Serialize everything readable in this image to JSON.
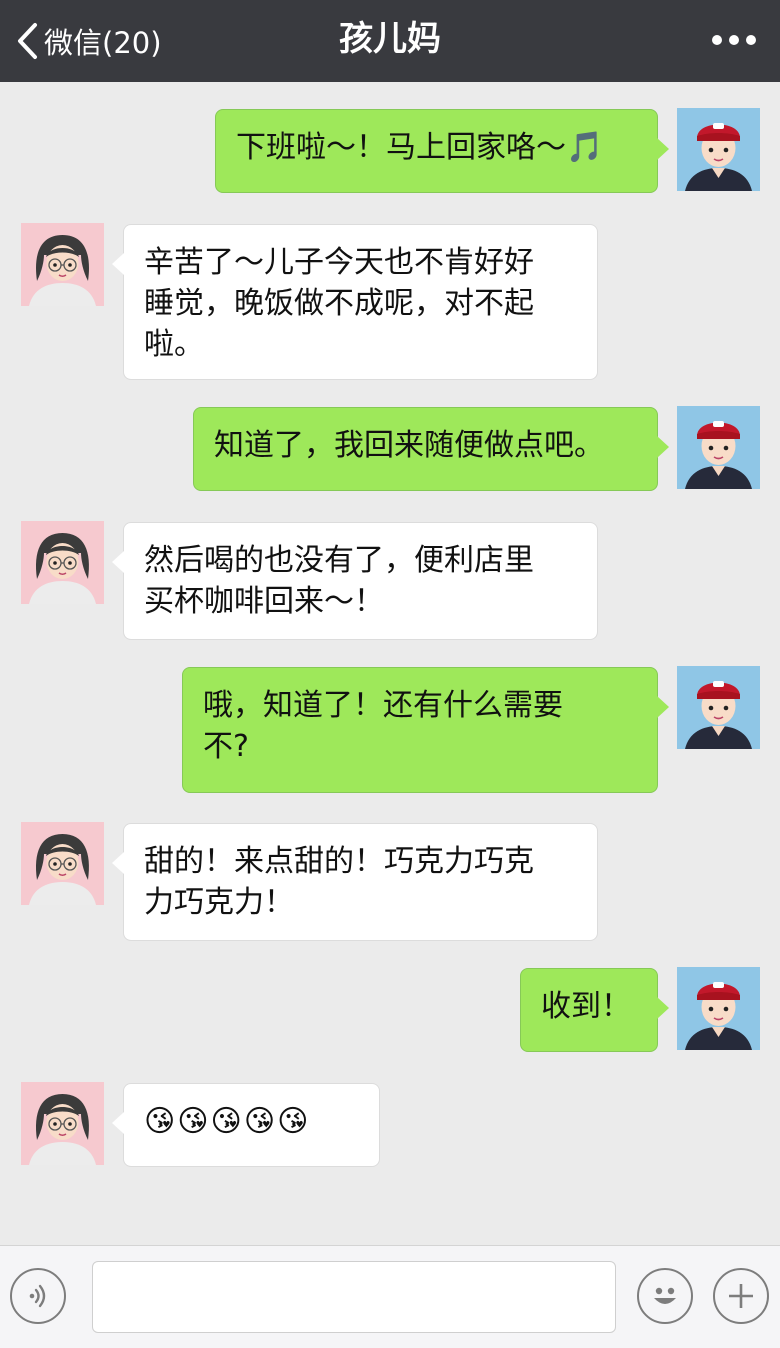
{
  "header": {
    "back_label": "微信(20)",
    "title": "孩儿妈",
    "more_icon": "more-dots-icon"
  },
  "messages": [
    {
      "side": "right",
      "text": "下班啦～！马上回家咯～🎵"
    },
    {
      "side": "left",
      "text": "辛苦了～儿子今天也不肯好好\n睡觉，晚饭做不成呢，对不起\n啦。"
    },
    {
      "side": "right",
      "text": "知道了，我回来随便做点吧。"
    },
    {
      "side": "left",
      "text": "然后喝的也没有了，便利店里\n买杯咖啡回来～！"
    },
    {
      "side": "right",
      "text": "哦，知道了！还有什么需要\n不?"
    },
    {
      "side": "left",
      "text": "甜的！来点甜的！巧克力巧克\n力巧克力！"
    },
    {
      "side": "right",
      "text": "收到！"
    },
    {
      "side": "left",
      "text": "😘😘😘😘😘"
    }
  ],
  "avatars": {
    "me": "boy-avatar-icon",
    "other": "girl-avatar-icon"
  },
  "input_bar": {
    "voice_icon": "voice-icon",
    "emoji_icon": "emoji-icon",
    "plus_icon": "plus-icon"
  },
  "colors": {
    "header_bg": "#393a3f",
    "chat_bg": "#ebebeb",
    "my_bubble": "#9ee85a",
    "their_bubble": "#ffffff"
  }
}
